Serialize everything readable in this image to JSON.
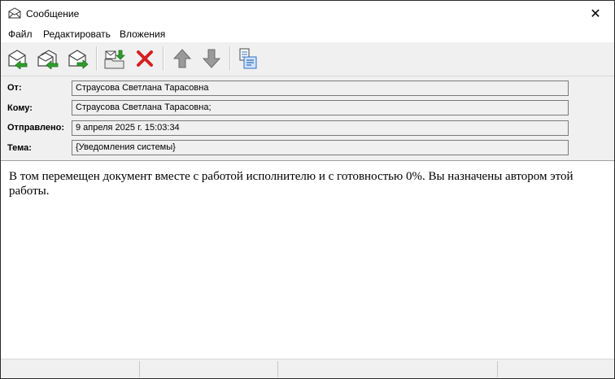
{
  "window": {
    "title": "Сообщение",
    "close_glyph": "✕"
  },
  "menu": {
    "items": [
      "Файл",
      "Редактировать",
      "Вложения"
    ]
  },
  "toolbar": {
    "icons": [
      "reply-icon",
      "reply-all-icon",
      "forward-icon",
      "save-to-folder-icon",
      "delete-icon",
      "previous-message-icon",
      "next-message-icon",
      "properties-icon"
    ],
    "colors": {
      "delete": "#d42020",
      "arrow": "#8c8c8c",
      "envelope": "#ffffff",
      "green": "#2e9e2e",
      "blue": "#2f6fc4"
    }
  },
  "headers": {
    "from": {
      "label": "От:",
      "value": "Страусова Светлана Тарасовна"
    },
    "to": {
      "label": "Кому:",
      "value": "Страусова Светлана Тарасовна;"
    },
    "sent": {
      "label": "Отправлено:",
      "value": "9 апреля 2025 г. 15:03:34"
    },
    "subject": {
      "label": "Тема:",
      "value": "{Уведомления системы}"
    }
  },
  "message": {
    "body": "В том перемещен документ вместе с работой исполнителю и с готовностью 0%. Вы назначены автором этой работы."
  }
}
